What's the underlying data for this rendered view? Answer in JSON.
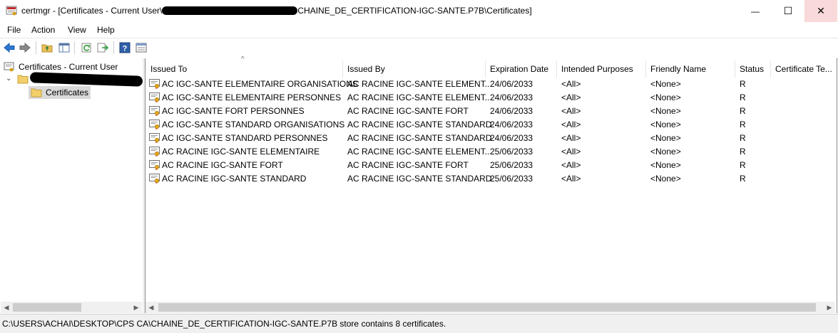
{
  "window": {
    "title_prefix": "certmgr - [Certificates - Current User\\",
    "title_suffix": "CHAINE_DE_CERTIFICATION-IGC-SANTE.P7B\\Certificates]",
    "minimize_glyph": "—",
    "maximize_glyph": "☐",
    "close_glyph": "✕",
    "close_bg": "#f9d9d9"
  },
  "menu": {
    "file": "File",
    "action": "Action",
    "view": "View",
    "help": "Help"
  },
  "toolbar": {
    "icons": [
      "back-arrow-icon",
      "forward-arrow-icon",
      "up-folder-icon",
      "show-hide-tree-icon",
      "refresh-icon",
      "export-list-icon",
      "help-icon",
      "properties-icon"
    ]
  },
  "tree": {
    "root_label": "Certificates - Current User",
    "child_label": "Certificates"
  },
  "table": {
    "columns": [
      "Issued To",
      "Issued By",
      "Expiration Date",
      "Intended Purposes",
      "Friendly Name",
      "Status",
      "Certificate Te..."
    ],
    "sort_glyph": "^",
    "rows": [
      {
        "issued_to": "AC IGC-SANTE ELEMENTAIRE ORGANISATIONS",
        "issued_by": "AC RACINE IGC-SANTE ELEMENT...",
        "expiration": "24/06/2033",
        "purposes": "<All>",
        "friendly": "<None>",
        "status": "R"
      },
      {
        "issued_to": "AC IGC-SANTE ELEMENTAIRE PERSONNES",
        "issued_by": "AC RACINE IGC-SANTE ELEMENT...",
        "expiration": "24/06/2033",
        "purposes": "<All>",
        "friendly": "<None>",
        "status": "R"
      },
      {
        "issued_to": "AC IGC-SANTE FORT PERSONNES",
        "issued_by": "AC RACINE IGC-SANTE FORT",
        "expiration": "24/06/2033",
        "purposes": "<All>",
        "friendly": "<None>",
        "status": "R"
      },
      {
        "issued_to": "AC IGC-SANTE STANDARD ORGANISATIONS",
        "issued_by": "AC RACINE IGC-SANTE STANDARD",
        "expiration": "24/06/2033",
        "purposes": "<All>",
        "friendly": "<None>",
        "status": "R"
      },
      {
        "issued_to": "AC IGC-SANTE STANDARD PERSONNES",
        "issued_by": "AC RACINE IGC-SANTE STANDARD",
        "expiration": "24/06/2033",
        "purposes": "<All>",
        "friendly": "<None>",
        "status": "R"
      },
      {
        "issued_to": "AC RACINE IGC-SANTE ELEMENTAIRE",
        "issued_by": "AC RACINE IGC-SANTE ELEMENT...",
        "expiration": "25/06/2033",
        "purposes": "<All>",
        "friendly": "<None>",
        "status": "R"
      },
      {
        "issued_to": "AC RACINE IGC-SANTE FORT",
        "issued_by": "AC RACINE IGC-SANTE FORT",
        "expiration": "25/06/2033",
        "purposes": "<All>",
        "friendly": "<None>",
        "status": "R"
      },
      {
        "issued_to": "AC RACINE IGC-SANTE STANDARD",
        "issued_by": "AC RACINE IGC-SANTE STANDARD",
        "expiration": "25/06/2033",
        "purposes": "<All>",
        "friendly": "<None>",
        "status": "R"
      }
    ]
  },
  "scroll": {
    "left_glyph": "◀",
    "right_glyph": "▶"
  },
  "status": {
    "text": "C:\\USERS\\ACHAI\\DESKTOP\\CPS CA\\CHAINE_DE_CERTIFICATION-IGC-SANTE.P7B store contains 8 certificates."
  }
}
